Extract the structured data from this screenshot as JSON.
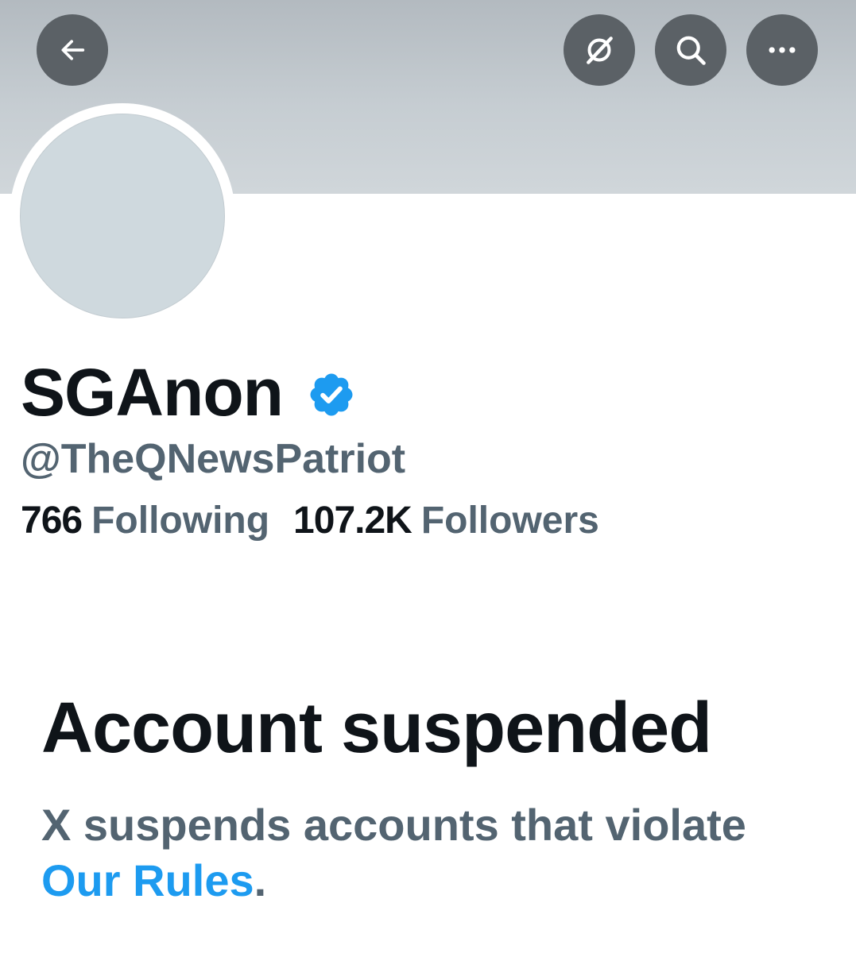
{
  "header": {
    "back_icon": "arrow-left-icon",
    "grok_icon": "grok-icon",
    "search_icon": "search-icon",
    "more_icon": "more-horizontal-icon",
    "button_color": "#5b6166",
    "banner_color": "#c6cdd2"
  },
  "profile": {
    "display_name": "SGAnon",
    "verified": true,
    "verified_color": "#1d9bf0",
    "handle": "@TheQNewsPatriot",
    "following_count": "766",
    "following_label": "Following",
    "followers_count": "107.2K",
    "followers_label": "Followers"
  },
  "suspension": {
    "title": "Account suspended",
    "message": "X suspends accounts that violate",
    "link_text": "Our Rules",
    "link_color": "#1d9bf0",
    "trailing": "."
  }
}
